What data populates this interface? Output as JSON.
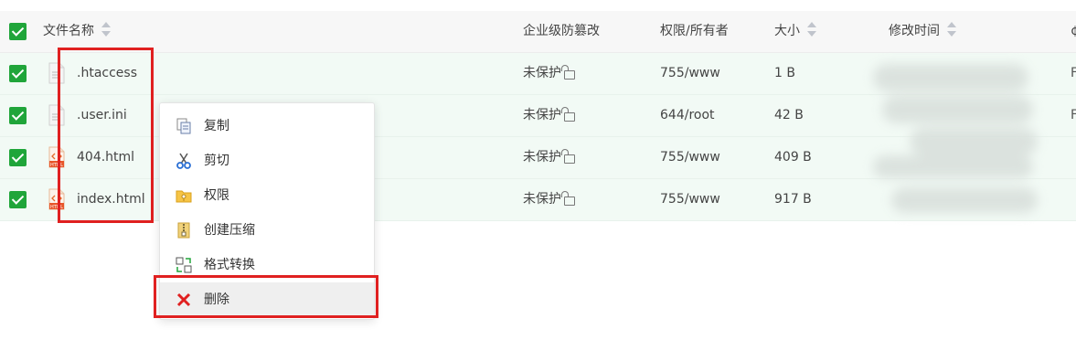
{
  "table": {
    "headers": {
      "name": "文件名称",
      "protect": "企业级防篡改",
      "perm": "权限/所有者",
      "size": "大小",
      "mtime": "修改时间",
      "edge": "¢"
    },
    "rows": [
      {
        "name": ".htaccess",
        "protect": "未保护",
        "perm": "755/www",
        "size": "1 B",
        "edge": "F",
        "type": "text"
      },
      {
        "name": ".user.ini",
        "protect": "未保护",
        "perm": "644/root",
        "size": "42 B",
        "edge": "F",
        "type": "text"
      },
      {
        "name": "404.html",
        "protect": "未保护",
        "perm": "755/www",
        "size": "409 B",
        "edge": "",
        "type": "html"
      },
      {
        "name": "index.html",
        "protect": "未保护",
        "perm": "755/www",
        "size": "917 B",
        "edge": "",
        "type": "html"
      }
    ]
  },
  "context_menu": {
    "items": [
      {
        "label": "复制",
        "icon": "copy-icon"
      },
      {
        "label": "剪切",
        "icon": "scissors-icon"
      },
      {
        "label": "权限",
        "icon": "folder-key-icon"
      },
      {
        "label": "创建压缩",
        "icon": "archive-icon"
      },
      {
        "label": "格式转换",
        "icon": "convert-icon"
      },
      {
        "label": "删除",
        "icon": "delete-x-icon"
      }
    ]
  },
  "colors": {
    "accent": "#20a53a",
    "highlight_box": "#e02020",
    "delete_icon": "#e02020",
    "row_bg": "#f2faf5"
  }
}
